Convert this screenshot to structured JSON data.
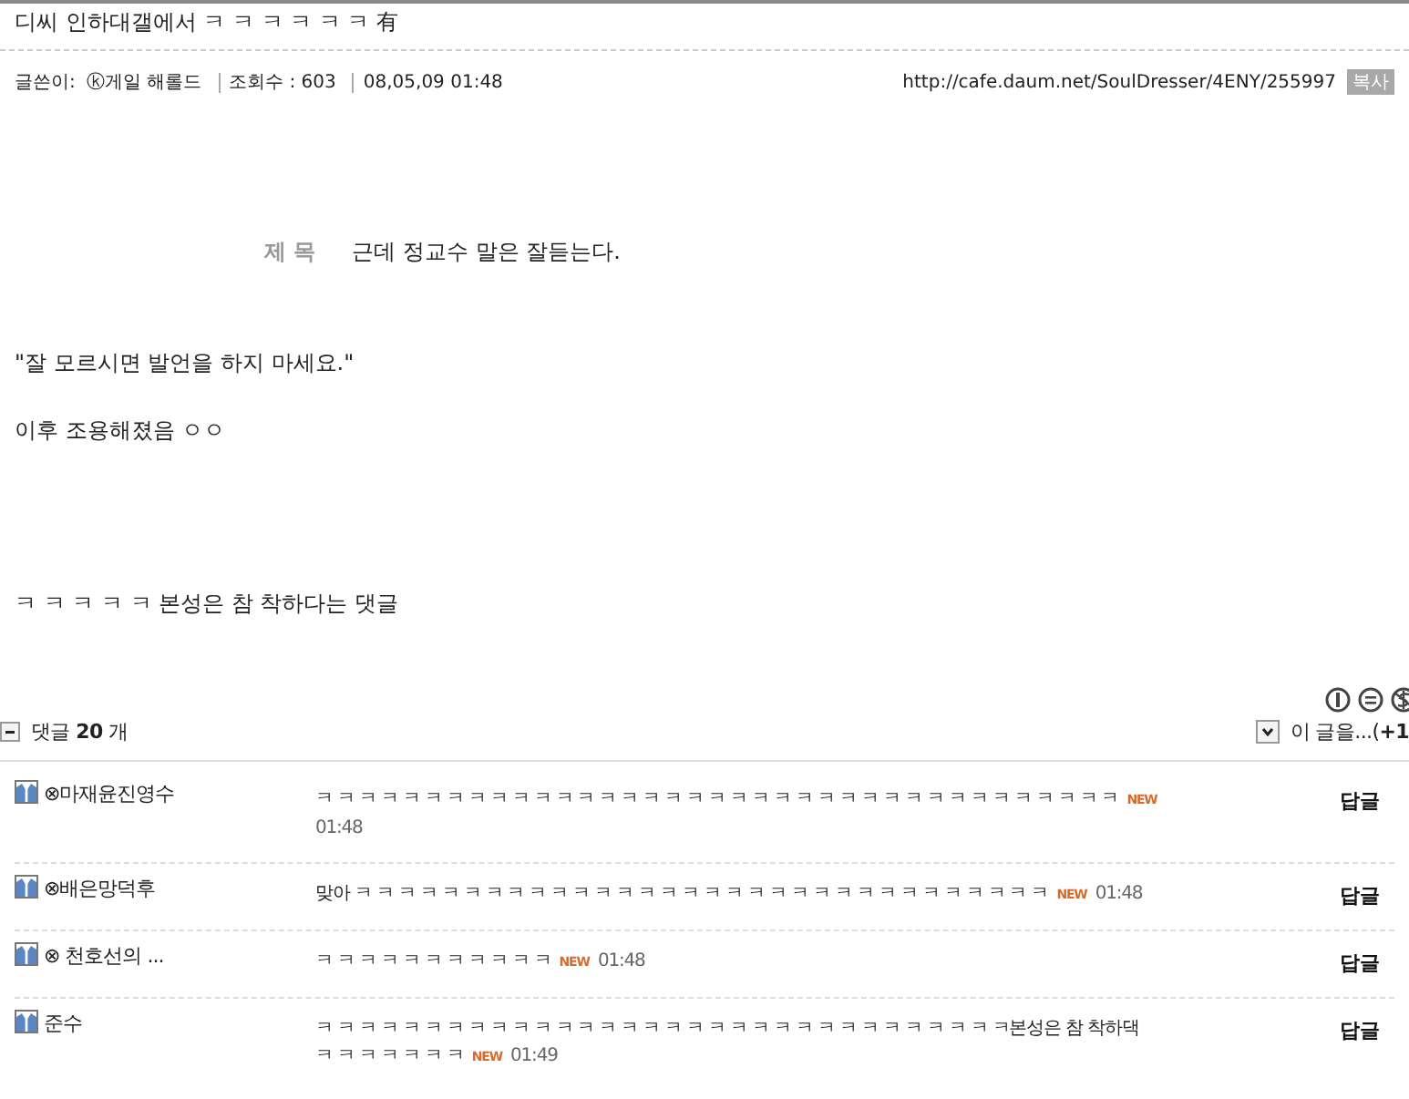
{
  "post": {
    "title": "디씨 인하대갤에서 ㅋ ㅋ ㅋ ㅋ ㅋ ㅋ 有",
    "author_label": "글쓴이:",
    "author": "ⓚ게일 해롤드",
    "views": "조회수 : 603",
    "date": "08,05,09 01:48",
    "url": "http://cafe.daum.net/SoulDresser/4ENY/255997",
    "copy_button": "복사",
    "subject_label": "제 목",
    "subject": "근데 정교수 말은 잘듣는다.",
    "paragraphs": [
      "\"잘 모르시면 발언을 하지 마세요.\"",
      "이후 조용해졌음 ㅇㅇ",
      "ㅋ ㅋ ㅋ ㅋ ㅋ 본성은 참 착하다는 댓글"
    ]
  },
  "comments_header": {
    "expanded": true,
    "label": "댓글 **20** 개",
    "more": "이 글을...(**+1**"
  },
  "comments": [
    {
      "author": "⊗마재윤진영수",
      "text": "ㅋ ㅋ ㅋ ㅋ ㅋ ㅋ ㅋ ㅋ ㅋ ㅋ ㅋ ㅋ ㅋ ㅋ ㅋ ㅋ ㅋ ㅋ ㅋ ㅋ ㅋ ㅋ ㅋ ㅋ ㅋ ㅋ ㅋ ㅋ ㅋ ㅋ ㅋ ㅋ ㅋ ㅋ ㅋ ㅋ ㅋ",
      "new_label": "NEW",
      "time": "01:48",
      "reply": "답글"
    },
    {
      "author": "⊗배은망덕후",
      "text": "맞아 ㅋ ㅋ ㅋ ㅋ ㅋ ㅋ ㅋ ㅋ ㅋ ㅋ ㅋ ㅋ ㅋ ㅋ ㅋ ㅋ ㅋ ㅋ ㅋ ㅋ ㅋ ㅋ ㅋ ㅋ ㅋ ㅋ ㅋ ㅋ ㅋ ㅋ ㅋ ㅋ",
      "new_label": "NEW",
      "time": "01:48",
      "reply": "답글"
    },
    {
      "author": "⊗ 천호선의 ...",
      "text": "ㅋ ㅋ ㅋ ㅋ ㅋ ㅋ ㅋ ㅋ ㅋ ㅋ ㅋ",
      "new_label": "NEW",
      "time": "01:48",
      "reply": "답글"
    },
    {
      "author": "준수",
      "text": "ㅋ ㅋ ㅋ ㅋ ㅋ ㅋ ㅋ ㅋ ㅋ ㅋ ㅋ ㅋ ㅋ ㅋ ㅋ ㅋ ㅋ ㅋ ㅋ ㅋ ㅋ ㅋ ㅋ ㅋ ㅋ ㅋ ㅋ ㅋ ㅋ ㅋ ㅋ ㅋ본성은 참 착하댁",
      "text2": "ㅋ ㅋ ㅋ ㅋ ㅋ ㅋ ㅋ",
      "new_label": "NEW",
      "time": "01:49",
      "reply": "답글"
    }
  ]
}
